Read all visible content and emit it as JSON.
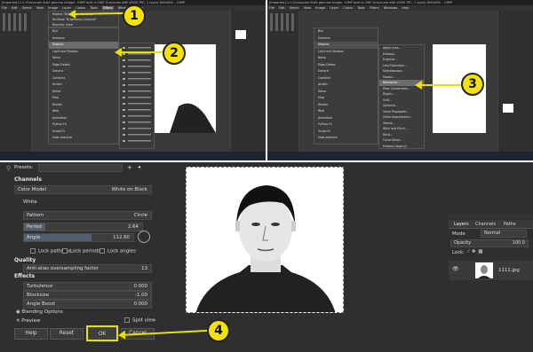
{
  "screens": {
    "top_left": {
      "titlebar": "[Imported]-1.0 (Grayscale 8-bit gamma integer, GIMP built-in D65 Grayscale with sRGB TRC, 1 layer) 800x800 – GIMP",
      "menus": [
        "File",
        "Edit",
        "Select",
        "View",
        "Image",
        "Layer",
        "Colors",
        "Tools",
        "Filters",
        "Windows",
        "Help"
      ],
      "recent": [
        "Repeat \"Brightness-Contrast\"",
        "Re-Show \"Brightness-Contrast\"",
        "Recently Used"
      ],
      "filters_menu": [
        "Blur",
        "Enhance",
        "Distorts",
        "Light and Shadow",
        "Noise",
        "Edge-Detect",
        "Generic",
        "Combine",
        "Artistic",
        "Decor",
        "Map",
        "Render",
        "Web",
        "Animation",
        "Python-Fu",
        "Script-Fu",
        "Goat-exercise"
      ],
      "highlighted": "Distorts",
      "status": "px  100%  1111.jpg (11.4 MB)"
    },
    "top_right": {
      "titlebar": "[Imported]-1.0 (Grayscale 8-bit gamma integer, GIMP built-in D65 Grayscale with sRGB TRC, 1 layer) 800x800 – GIMP",
      "status": "ft+Click to fixed-bottomline and outline recalculations",
      "distorts_menu": [
        "Apply Lens...",
        "Emboss...",
        "Engrave...",
        "Lens Distortion...",
        "Kaleidoscope...",
        "Mosaic...",
        "Newsprint...",
        "Polar Coordinates...",
        "Ripple...",
        "Shift...",
        "Spherize...",
        "Value Propagate...",
        "Video Degradation...",
        "Waves...",
        "Whirl and Pinch...",
        "Wind...",
        "Curve Bend...",
        "Emboss (legacy)..."
      ],
      "highlighted": "Newsprint..."
    }
  },
  "callouts": [
    "1",
    "2",
    "3",
    "4"
  ],
  "dialog": {
    "presets_label": "Presets:",
    "channels": "Channels",
    "color_model_label": "Color Model",
    "color_model_value": "White on Black",
    "white_label": "White",
    "pattern_label": "Pattern",
    "pattern_value": "Circle",
    "period_label": "Period",
    "period_value": "2.64",
    "angle_label": "Angle",
    "angle_value": "112.60",
    "lock_patterns": "Lock patterns",
    "lock_periods": "Lock periods",
    "lock_angles": "Lock angles",
    "quality": "Quality",
    "aa_label": "Anti-alias oversampling factor",
    "aa_value": "13",
    "effects": "Effects",
    "turbulence_label": "Turbulence",
    "turbulence_value": "0.000",
    "blocksize_label": "Blocksize",
    "blocksize_value": "-1.00",
    "angle_boost_label": "Angle Boost",
    "angle_boost_value": "0.000",
    "blending_options": "Blending Options",
    "preview": "Preview",
    "split_view": "Split view",
    "help": "Help",
    "reset": "Reset",
    "ok": "OK",
    "cancel": "Cancel",
    "angle_progress": 0.62,
    "period_progress": 0.18
  },
  "layers_panel": {
    "tabs": [
      "Layers",
      "Channels",
      "Paths"
    ],
    "mode_label": "Mode",
    "mode_value": "Normal",
    "opacity_label": "Opacity",
    "opacity_value": "100.0",
    "lock_label": "Lock:",
    "layer_name": "1111.jpg"
  },
  "colors": {
    "callout_yellow": "#f5e200",
    "bg": "#2f2f2f"
  }
}
